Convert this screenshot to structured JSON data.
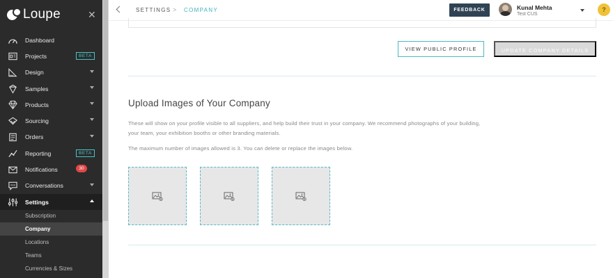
{
  "brand": {
    "name": "Loupe"
  },
  "sidebar": {
    "items": [
      {
        "label": "Dashboard",
        "icon": "dashboard-icon"
      },
      {
        "label": "Projects",
        "icon": "projects-icon",
        "badge": "BETA"
      },
      {
        "label": "Design",
        "icon": "design-icon",
        "expandable": true
      },
      {
        "label": "Samples",
        "icon": "samples-icon",
        "expandable": true
      },
      {
        "label": "Products",
        "icon": "products-icon",
        "expandable": true
      },
      {
        "label": "Sourcing",
        "icon": "sourcing-icon",
        "expandable": true
      },
      {
        "label": "Orders",
        "icon": "orders-icon",
        "expandable": true
      },
      {
        "label": "Reporting",
        "icon": "reporting-icon",
        "badge": "BETA"
      },
      {
        "label": "Notifications",
        "icon": "notifications-icon",
        "count": "30"
      },
      {
        "label": "Conversations",
        "icon": "conversations-icon",
        "expandable": true
      },
      {
        "label": "Settings",
        "icon": "settings-icon",
        "expanded": true
      }
    ],
    "subitems": [
      {
        "label": "Subscription"
      },
      {
        "label": "Company"
      },
      {
        "label": "Locations"
      },
      {
        "label": "Teams"
      },
      {
        "label": "Currencies & Sizes"
      }
    ]
  },
  "header": {
    "breadcrumb": [
      "SETTINGS",
      "COMPANY"
    ],
    "feedback_label": "FEEDBACK",
    "user": {
      "name": "Kunal Mehta",
      "org": "Test CUS"
    },
    "help_label": "?"
  },
  "main": {
    "view_profile_label": "VIEW PUBLIC PROFILE",
    "update_label": "UPDATE COMPANY DETAILS",
    "upload": {
      "title": "Upload Images of Your Company",
      "description": "These will show on your profile visible to all suppliers, and help build their trust in your company. We recommend photographs of your building, your team, your exhibition booths or other branding materials.",
      "max_note": "The maximum number of images allowed is 3. You can delete or replace the images below."
    }
  },
  "colors": {
    "accent": "#3fb3bb",
    "sidebar_bg": "#2b2b2b",
    "feedback_bg": "#2f4354",
    "badge_red": "#e04848",
    "help_yellow": "#f0c23a"
  }
}
